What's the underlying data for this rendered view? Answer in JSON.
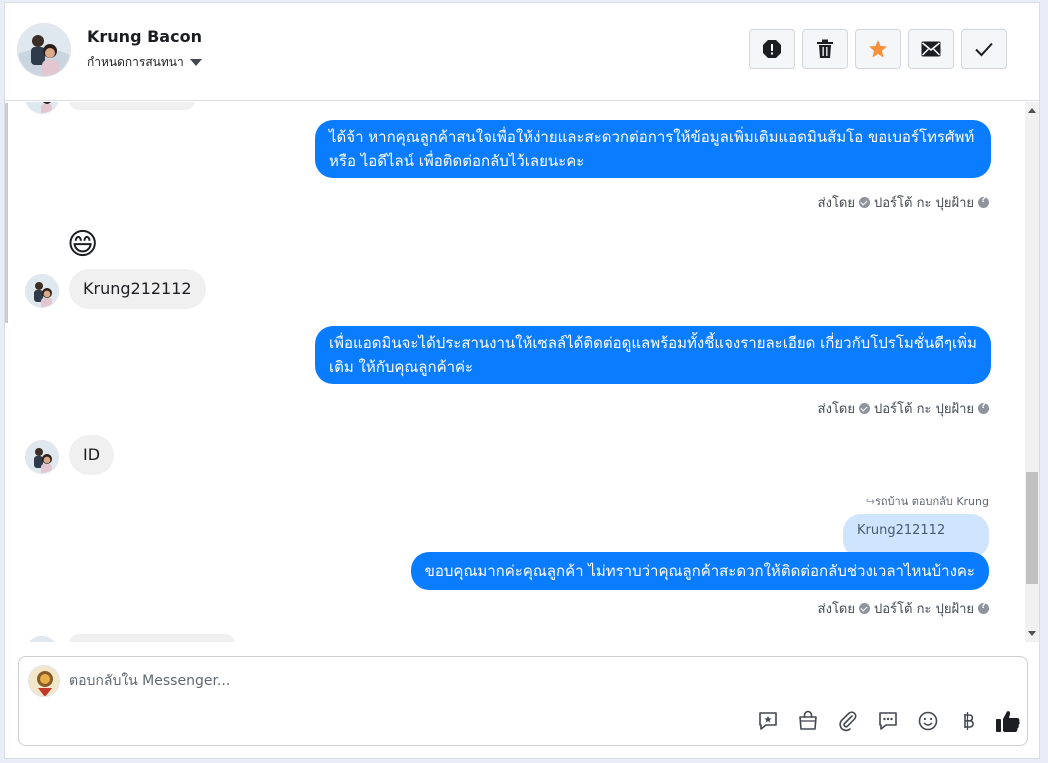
{
  "header": {
    "contact_name": "Krung Bacon",
    "assign_label": "กำหนดการสนทนา",
    "actions": [
      {
        "icon": "alert-icon",
        "name": "mark-spam-button"
      },
      {
        "icon": "trash-icon",
        "name": "delete-button"
      },
      {
        "icon": "star-icon",
        "name": "star-button"
      },
      {
        "icon": "envelope-icon",
        "name": "mark-unread-button"
      },
      {
        "icon": "check-icon",
        "name": "mark-done-button"
      }
    ],
    "star_color": "#f7923b"
  },
  "messages": {
    "m1_text": "ได้จ้า หากคุณลูกค้าสนใจเพื่อให้ง่ายและสะดวกต่อการให้ข้อมูลเพิ่มเติมแอดมินส้มโอ ขอเบอร์โทรศัพท์ หรือ ไอดีไลน์ เพื่อติดต่อกลับไว้เลยนะคะ",
    "emoji": "😄",
    "m2_text": "Krung212112",
    "m3_text": "เพื่อแอดมินจะได้ประสานงานให้เซลล์ได้ติดต่อดูแลพร้อมทั้งชี้แจงรายละเอียด เกี่ยวกับโปรโมชั่นดีๆเพิ่มเติม ให้กับคุณลูกค้าค่ะ",
    "m4_text": "ID",
    "reply_note": "รถบ้าน ตอบกลับ Krung",
    "quoted_text": "Krung212112",
    "m5_text": "ขอบคุณมากค่ะคุณลูกค้า ไม่ทราบว่าคุณลูกค้าสะดวกให้ติดต่อกลับช่วงเวลาไหนบ้างคะ",
    "sent_by_prefix": "ส่งโดย",
    "sent_by_name": "ปอร์โต้ กะ ปุยฝ้าย"
  },
  "colors": {
    "outgoing_bubble": "#0a7cff",
    "incoming_bubble": "#f0f0f0",
    "send_like": "#1c1e21"
  },
  "composer": {
    "placeholder": "ตอบกลับใน Messenger...",
    "tools": [
      "saved-reply-icon",
      "shop-bag-icon",
      "attach-icon",
      "quick-reply-icon",
      "emoji-icon",
      "baht-icon",
      "like-icon"
    ]
  }
}
